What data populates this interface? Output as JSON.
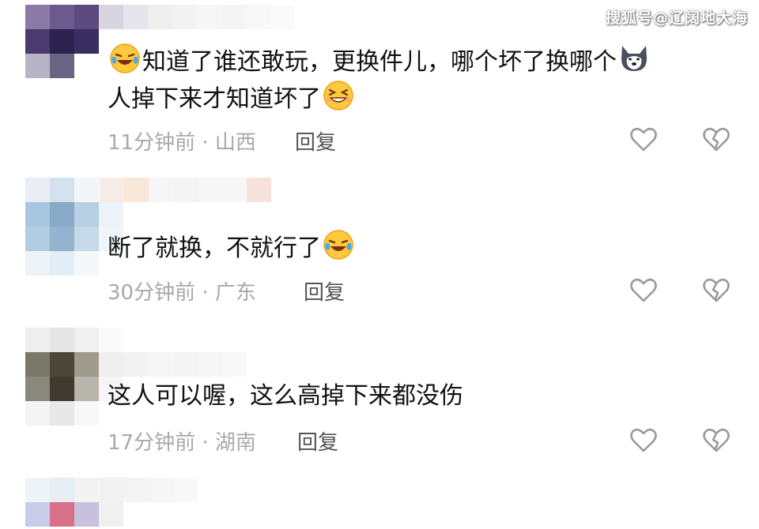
{
  "watermark": "搜狐号@辽阔地大海",
  "comments": [
    {
      "text_line1": "知道了谁还敢玩，更换件儿，哪个坏了换哪个",
      "text_line2": "人掉下来才知道坏了",
      "time": "11分钟前",
      "location": "山西",
      "reply_label": "回复",
      "emoji_icons": [
        "laugh-cry-icon",
        "husky-dog-icon",
        "grin-squint-icon"
      ],
      "avatar_colors": [
        "#8a7ba6",
        "#6b5a8e",
        "#5a4a7e",
        "#d0cce0",
        "#4a3a6e",
        "#2c2250",
        "#3a2e60",
        "#ffffff",
        "#b8b4c8",
        "#6a6484",
        "#ffffff",
        "#ffffff"
      ],
      "name_colors": [
        "#d8d4e0",
        "#e6e4ec",
        "#eeeeee",
        "#f2f2f2",
        "#f6f6f6",
        "#f4f4f4",
        "#f8f8f8",
        "#fafafa"
      ]
    },
    {
      "text_line1": "断了就换，不就行了",
      "time": "30分钟前",
      "location": "广东",
      "reply_label": "回复",
      "emoji_icons": [
        "laugh-cry-icon"
      ],
      "avatar_colors": [
        "#e8eef4",
        "#d4e2ee",
        "#f2f6fa",
        "#fafcfd",
        "#a8c6e0",
        "#88aac8",
        "#b8d0e4",
        "#eef3f8",
        "#b2cde2",
        "#93b3cf",
        "#c6dae9",
        "#f0f5f9",
        "#eef3f8",
        "#e3edf5",
        "#f5f8fb",
        "#ffffff"
      ],
      "name_colors": [
        "#f6ece6",
        "#f8e6d8",
        "#f6f6f6",
        "#f4f4f4",
        "#f6f6f6",
        "#f6f6f6",
        "#f8e2dc"
      ]
    },
    {
      "text_line1": "这人可以喔，这么高掉下来都没伤",
      "time": "17分钟前",
      "location": "湖南",
      "reply_label": "回复",
      "emoji_icons": [],
      "avatar_colors": [
        "#eeeeee",
        "#e6e6e6",
        "#f0f0f0",
        "#fafafa",
        "#7a7868",
        "#4a4638",
        "#a09c8c",
        "#f4f4f4",
        "#8a887c",
        "#3e3a30",
        "#b8b6ac",
        "#f6f6f6",
        "#f4f4f4",
        "#e8e8e8",
        "#f8f8f8",
        "#ffffff"
      ],
      "name_colors": [
        "#efefef",
        "#f2f2f2",
        "#f6f6f6",
        "#f4f4f4",
        "#f6f6f6",
        "#f8f8f8"
      ]
    },
    {
      "avatar_colors": [
        "#eef4f8",
        "#e6eef4",
        "#f3f3f3",
        "#f8f8f8",
        "#c8cce8",
        "#d87088",
        "#c8c0dc",
        "#f0f0f0"
      ],
      "name_colors": [
        "#f2f2f2",
        "#f4f4f4",
        "#f6f6f6",
        "#f8f8f8"
      ]
    }
  ]
}
